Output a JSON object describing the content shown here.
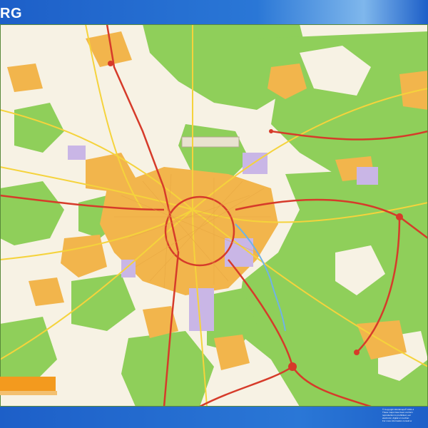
{
  "header": {
    "title": "RG",
    "bar_color": "#1d5fc8"
  },
  "map": {
    "forest_color": "#8fcf5a",
    "urban_color": "#f2b54c",
    "industrial_color": "#c9b6e6",
    "background_color": "#f7f2e4",
    "motorway_color": "#d63b2a",
    "main_road_color": "#f5d33c"
  },
  "footer": {
    "copyright_lines": [
      "© Copyright Worldmaps® 1991-2",
      "These maps have been conform",
      "reproduction is prohibited, exc",
      "electronic, digital or mechan",
      "For more information consult w"
    ],
    "accent_color": "#f39a1e"
  }
}
